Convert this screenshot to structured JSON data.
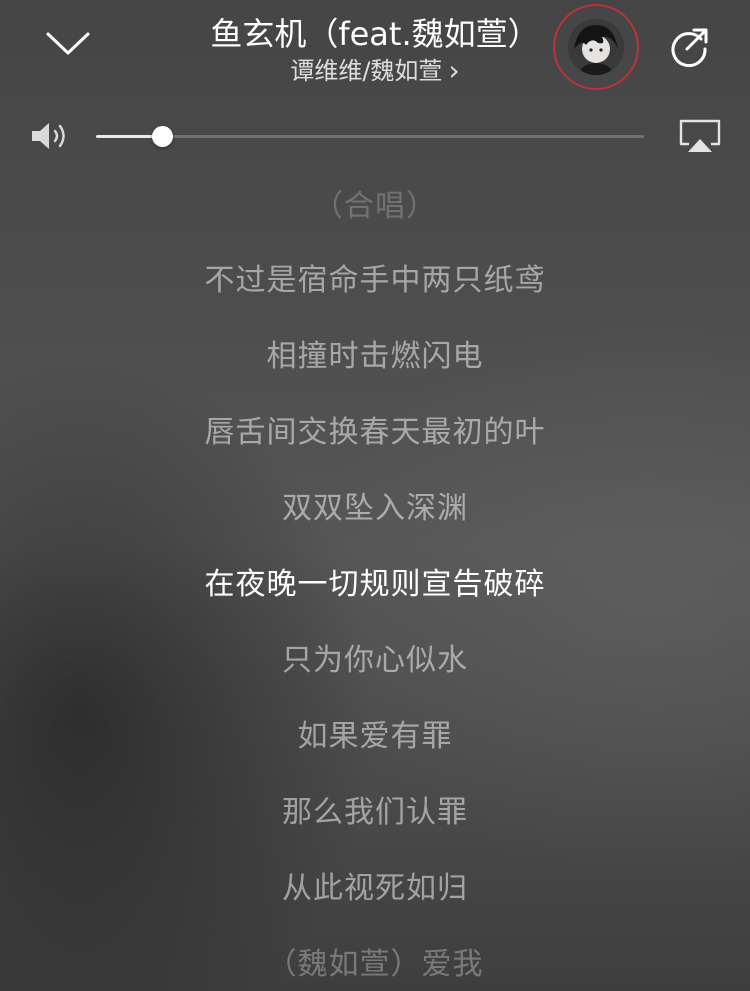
{
  "header": {
    "song_title": "鱼玄机（feat.魏如萱）",
    "artists": "谭维维/魏如萱",
    "artist_chevron": "›"
  },
  "volume": {
    "level": 0.12
  },
  "lyrics": {
    "lines": [
      "（合唱）",
      "不过是宿命手中两只纸鸢",
      "相撞时击燃闪电",
      "唇舌间交换春天最初的叶",
      "双双坠入深渊",
      "在夜晚一切规则宣告破碎",
      "只为你心似水",
      "如果爱有罪",
      "那么我们认罪",
      "从此视死如归",
      "（魏如萱）爱我"
    ],
    "current_index": 5
  },
  "icons": {
    "collapse": "chevron-down-icon",
    "share": "share-icon",
    "speaker": "speaker-icon",
    "airplay": "airplay-icon"
  },
  "colors": {
    "avatar_ring": "#b8333c",
    "current_lyric": "#ffffff"
  }
}
